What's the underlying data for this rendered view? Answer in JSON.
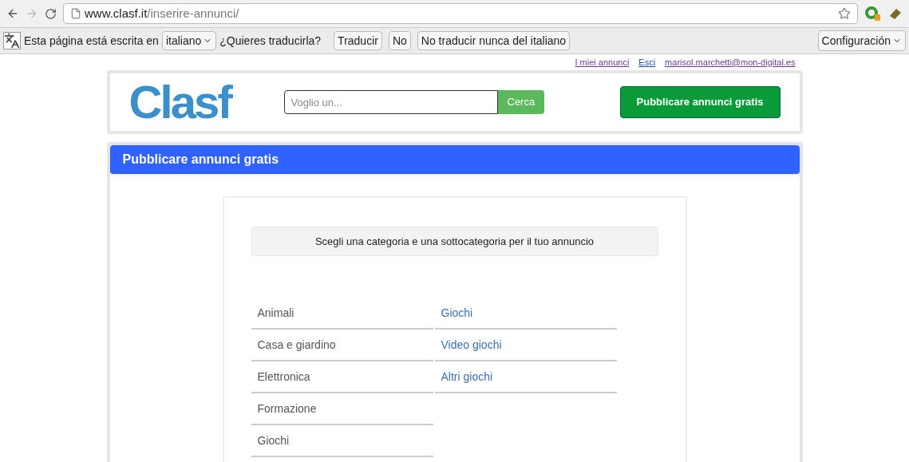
{
  "browser": {
    "url_host": "www.clasf.it",
    "url_path": "/inserire-annunci/"
  },
  "translate_bar": {
    "message": "Esta página está escrita en",
    "language": "italiano",
    "question": "¿Quieres traducirla?",
    "buttons": [
      "Traducir",
      "No",
      "No traducir nunca del italiano"
    ],
    "settings": "Configuración"
  },
  "user_links": [
    "I miei annunci",
    "Esci",
    "marisol.marchetti@mon-digital.es"
  ],
  "header": {
    "logo": "Clasf",
    "search": {
      "placeholder": "Voglio un..."
    },
    "search_button": "Cerca",
    "post_button": "Pubblicare annunci gratis"
  },
  "page_title": "Pubblicare annunci gratis",
  "instruction": "Scegli una categoria e una sottocategoria per il tuo annuncio",
  "categories": [
    "Animali",
    "Casa e giardino",
    "Elettronica",
    "Formazione",
    "Giochi"
  ],
  "subcategories": [
    "Giochi",
    "Video giochi",
    "Altri giochi"
  ]
}
